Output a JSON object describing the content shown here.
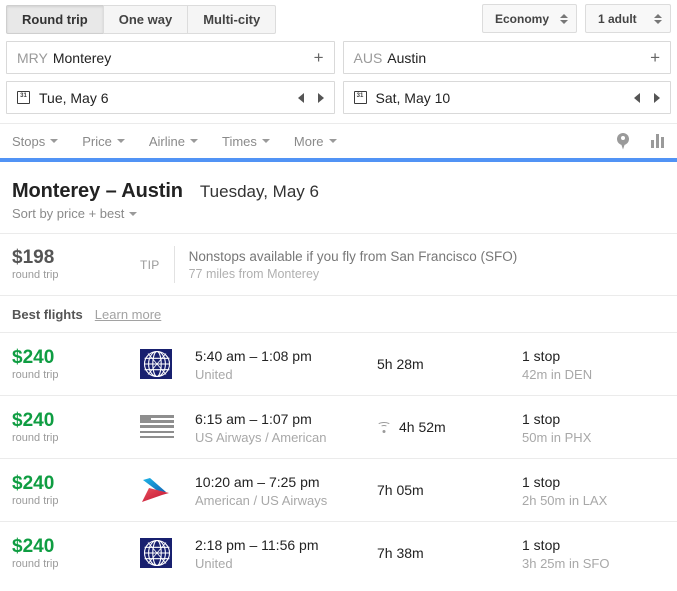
{
  "search": {
    "trip_tabs": [
      {
        "label": "Round trip",
        "active": true
      },
      {
        "label": "One way",
        "active": false
      },
      {
        "label": "Multi-city",
        "active": false
      }
    ],
    "cabin_class": "Economy",
    "passengers": "1 adult",
    "origin": {
      "code": "MRY",
      "city": "Monterey",
      "add_label": "+"
    },
    "destination": {
      "code": "AUS",
      "city": "Austin",
      "add_label": "+"
    },
    "depart_date": "Tue, May 6",
    "return_date": "Sat, May 10",
    "calendar_icon_day": "31"
  },
  "filters": {
    "items": [
      {
        "label": "Stops"
      },
      {
        "label": "Price"
      },
      {
        "label": "Airline"
      },
      {
        "label": "Times"
      },
      {
        "label": "More"
      }
    ],
    "map_icon": "map-pin-icon",
    "chart_icon": "price-graph-icon"
  },
  "results": {
    "route_title": "Monterey – Austin",
    "route_date": "Tuesday, May 6",
    "sort_by": "Sort by price + best",
    "tip": {
      "price": "$198",
      "price_sub": "round trip",
      "label": "TIP",
      "line1": "Nonstops available if you fly from San Francisco (SFO)",
      "line2": "77 miles from Monterey"
    },
    "best_flights_title": "Best flights",
    "learn_more": "Learn more",
    "flights": [
      {
        "price": "$240",
        "price_sub": "round trip",
        "logo": "united-logo",
        "times": "5:40 am – 1:08 pm",
        "airline": "United",
        "duration": "5h 28m",
        "wifi": false,
        "stops": "1 stop",
        "layover": "42m in DEN"
      },
      {
        "price": "$240",
        "price_sub": "round trip",
        "logo": "usairways-logo",
        "times": "6:15 am – 1:07 pm",
        "airline": "US Airways / American",
        "duration": "4h 52m",
        "wifi": true,
        "stops": "1 stop",
        "layover": "50m in PHX"
      },
      {
        "price": "$240",
        "price_sub": "round trip",
        "logo": "american-logo",
        "times": "10:20 am – 7:25 pm",
        "airline": "American / US Airways",
        "duration": "7h 05m",
        "wifi": false,
        "stops": "1 stop",
        "layover": "2h 50m in LAX"
      },
      {
        "price": "$240",
        "price_sub": "round trip",
        "logo": "united-logo",
        "times": "2:18 pm – 11:56 pm",
        "airline": "United",
        "duration": "7h 38m",
        "wifi": false,
        "stops": "1 stop",
        "layover": "3h 25m in SFO"
      }
    ]
  },
  "colors": {
    "accent_blue": "#5193f5",
    "price_green": "#0f9d42",
    "united_blue": "#18206f",
    "american_blue": "#1a9ad8",
    "american_red": "#cc2233"
  }
}
